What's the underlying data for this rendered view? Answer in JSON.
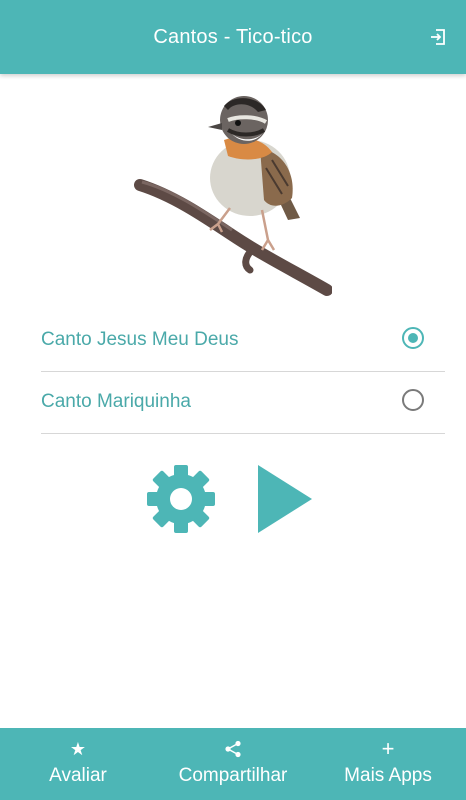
{
  "app_bar": {
    "title": "Cantos - Tico-tico",
    "exit_icon": "exit-icon"
  },
  "bird_image": {
    "icon": "bird-on-branch-picture"
  },
  "options": [
    {
      "label": "Canto Jesus Meu Deus",
      "selected": true
    },
    {
      "label": "Canto Mariquinha",
      "selected": false
    }
  ],
  "controls": {
    "settings_icon": "gear-icon",
    "play_icon": "play-icon"
  },
  "bottom_nav": [
    {
      "icon": "star-icon",
      "glyph": "★",
      "label": "Avaliar"
    },
    {
      "icon": "share-icon",
      "glyph": "",
      "label": "Compartilhar"
    },
    {
      "icon": "plus-icon",
      "glyph": "+",
      "label": "Mais Apps"
    }
  ],
  "colors": {
    "primary": "#4db6b6",
    "text_teal": "#4aa9a9",
    "divider": "#d7d7d7"
  }
}
